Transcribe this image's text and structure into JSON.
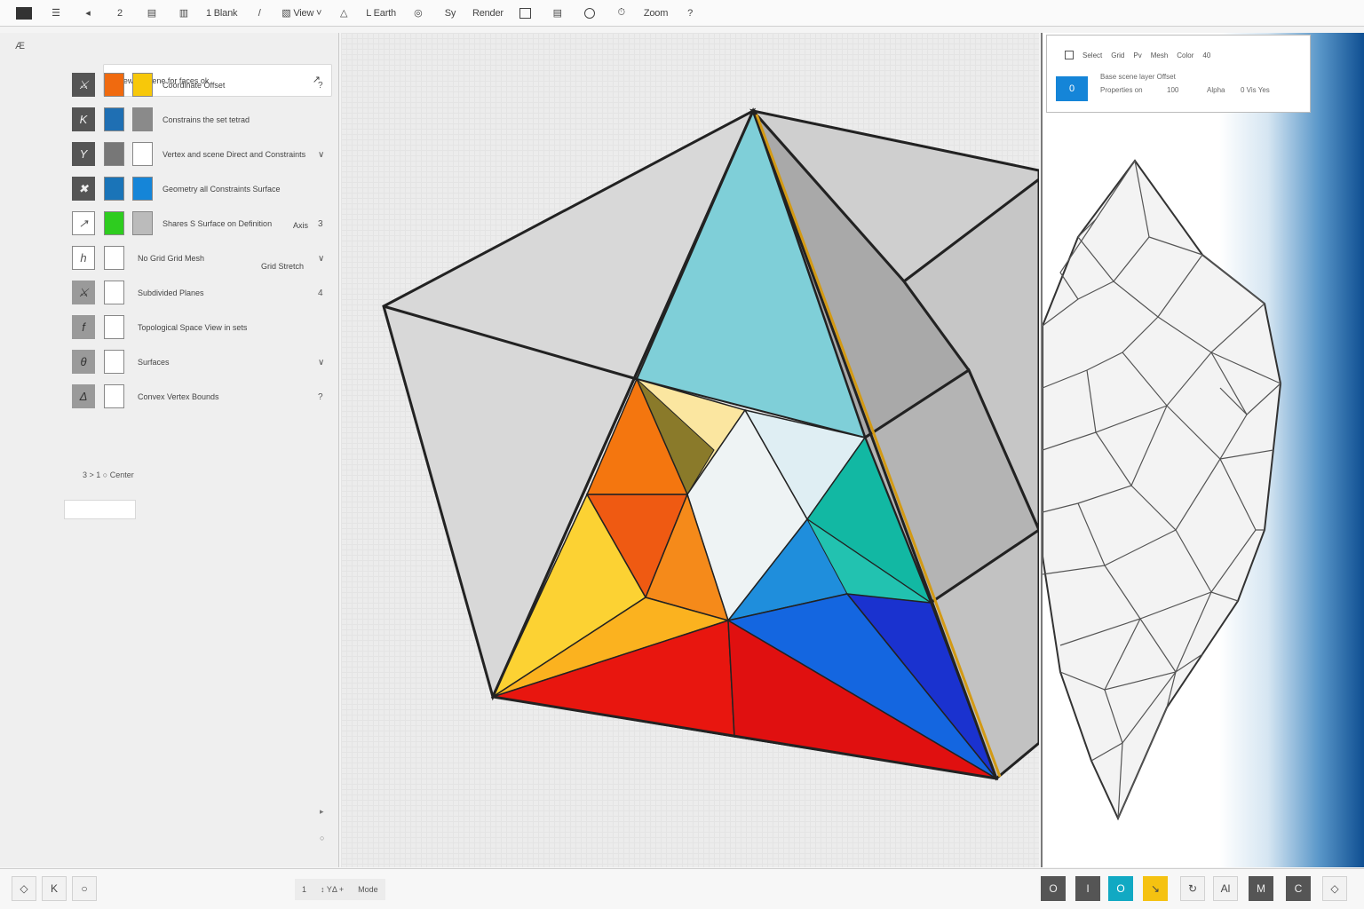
{
  "toolbar": {
    "items": [
      {
        "name": "app-menu-icon",
        "type": "sq"
      },
      {
        "name": "menu-icon",
        "label": "☰"
      },
      {
        "name": "back-icon",
        "label": "◂"
      },
      {
        "name": "redo-icon",
        "label": "2"
      },
      {
        "name": "save-icon",
        "label": "▤"
      },
      {
        "name": "layers-icon",
        "label": "▥"
      },
      {
        "name": "blank-button",
        "label": "1 Blank",
        "text": true
      },
      {
        "name": "pen-icon",
        "label": "/"
      },
      {
        "name": "select-view",
        "label": "▧  View ˅",
        "text": true
      },
      {
        "name": "shape-icon",
        "label": "△"
      },
      {
        "name": "earth-button",
        "label": "L Earth",
        "text": true
      },
      {
        "name": "target-icon",
        "label": "◎"
      },
      {
        "name": "sy-button",
        "label": "Sy",
        "text": true
      },
      {
        "name": "render-button",
        "label": "Render",
        "text": true
      },
      {
        "name": "frame-icon",
        "type": "box"
      },
      {
        "name": "page-icon",
        "label": "▤"
      },
      {
        "name": "circle-icon",
        "type": "circ"
      },
      {
        "name": "timer-icon",
        "label": "⏱"
      },
      {
        "name": "zoom-button",
        "label": "Zoom",
        "text": true
      },
      {
        "name": "help-icon",
        "label": "?"
      }
    ]
  },
  "left_panel": {
    "corner": "Æ",
    "search_placeholder": "View in scene for faces ok",
    "search_arrow": "↗",
    "rows": [
      {
        "icon": "⚔",
        "icon_style": "dark",
        "swatches": [
          "#f06a0f",
          "#f7c80a"
        ],
        "label": "Coordinate Offset",
        "chev": "?"
      },
      {
        "icon": "K",
        "icon_style": "dark",
        "swatches": [
          "#1f6fb3",
          "#8a8a8a"
        ],
        "label": "Constrains the set tetrad",
        "chev": ""
      },
      {
        "icon": "Y",
        "icon_style": "dark",
        "swatches": [
          "#777777",
          "#ffffff"
        ],
        "label": "Vertex and scene Direct and Constraints",
        "chev": "∨"
      },
      {
        "icon": "✖",
        "icon_style": "dark",
        "swatches": [
          "#1a74b8",
          "#1585d8"
        ],
        "label": "Geometry all Constraints Surface",
        "chev": ""
      },
      {
        "icon": "↗",
        "icon_style": "light",
        "swatches": [
          "#2ecc1f",
          "#bbbbbb"
        ],
        "label": "Shares S Surface on Definition",
        "chev": "3",
        "extra": "Axis"
      },
      {
        "icon": "h",
        "icon_style": "light",
        "swatches": [
          "#ffffff"
        ],
        "label": "No Grid Grid Mesh",
        "chev": "∨",
        "extra": "Grid Stretch"
      },
      {
        "icon": "⚔",
        "icon_style": "grey",
        "swatches": [
          "#ffffff"
        ],
        "label": "Subdivided Planes",
        "chev": "4"
      },
      {
        "icon": "f",
        "icon_style": "grey",
        "swatches": [
          "#ffffff"
        ],
        "label": "Topological Space View in sets",
        "chev": ""
      },
      {
        "icon": "θ",
        "icon_style": "grey",
        "swatches": [
          "#ffffff"
        ],
        "label": "Surfaces",
        "chev": "∨"
      },
      {
        "icon": "Δ",
        "icon_style": "grey",
        "swatches": [
          "#ffffff"
        ],
        "label": "Convex Vertex Bounds",
        "chev": "?"
      }
    ],
    "footer_label": "3 > 1  ○ Center",
    "scroll_down": "▸",
    "scroll_dot": "○"
  },
  "right_panel": {
    "row1": [
      "Select",
      "Grid",
      "Pv",
      "Mesh",
      "Color",
      "40"
    ],
    "button_label": "0",
    "line1": "Base scene layer Offset",
    "line2": "Properties on",
    "line2_value": "100",
    "line2_extra": "Alpha",
    "line2_end": "0 Vis Yes"
  },
  "bottom_bar": {
    "status": [
      "1",
      "↕ YΔ +",
      "Mode"
    ],
    "left_buttons": [
      "◇",
      "K",
      "○"
    ],
    "right_buttons": [
      {
        "label": "O",
        "style": "dark"
      },
      {
        "label": "I",
        "style": "dark"
      },
      {
        "label": "O",
        "style": "teal"
      },
      {
        "label": "↘",
        "style": "yellow"
      },
      {
        "label": "↻",
        "style": "plain"
      },
      {
        "label": "Al",
        "style": "plain"
      },
      {
        "label": "M",
        "style": "dark"
      },
      {
        "label": "C",
        "style": "dark"
      },
      {
        "label": "◇",
        "style": "plain"
      }
    ]
  },
  "colors": {
    "accent": "#1585d8",
    "red": "#e41411",
    "yellow": "#fbd12f",
    "orange": "#f4700f",
    "teal": "#10b9a4",
    "blue": "#1447d8",
    "cyan": "#6ec6d4"
  }
}
